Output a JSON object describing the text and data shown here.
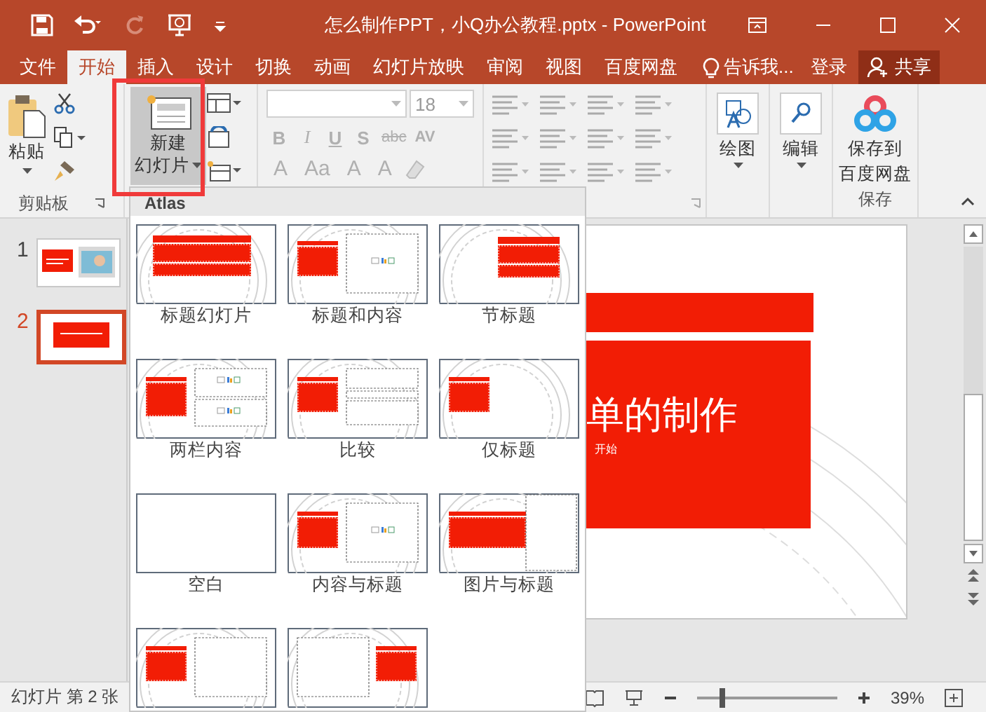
{
  "window": {
    "title": "怎么制作PPT，小Q办公教程.pptx - PowerPoint"
  },
  "tabs": [
    {
      "label": "文件",
      "selected": false
    },
    {
      "label": "开始",
      "selected": true
    },
    {
      "label": "插入",
      "selected": false
    },
    {
      "label": "设计",
      "selected": false
    },
    {
      "label": "切换",
      "selected": false
    },
    {
      "label": "动画",
      "selected": false
    },
    {
      "label": "幻灯片放映",
      "selected": false
    },
    {
      "label": "审阅",
      "selected": false
    },
    {
      "label": "视图",
      "selected": false
    },
    {
      "label": "百度网盘",
      "selected": false
    }
  ],
  "tell_me": "告诉我...",
  "sign_in": "登录",
  "share": "共享",
  "ribbon": {
    "clipboard": {
      "paste": "粘贴",
      "group_label": "剪贴板"
    },
    "slides": {
      "new_slide": [
        "新建",
        "幻灯片"
      ]
    },
    "font": {
      "size": "18",
      "row1": [
        {
          "label": "B",
          "disabled": true
        },
        {
          "label": "I",
          "disabled": true
        },
        {
          "label": "U",
          "disabled": true
        },
        {
          "label": "S",
          "disabled": true
        },
        {
          "label": "abc",
          "disabled": true
        },
        {
          "label": "AV",
          "disabled": true
        }
      ],
      "row2": [
        {
          "label": "A",
          "disabled": true
        },
        {
          "label": "Aa",
          "disabled": true
        },
        {
          "label": "A",
          "disabled": true
        },
        {
          "label": "A",
          "disabled": true
        }
      ]
    },
    "drawing": "绘图",
    "editing": "编辑",
    "save": {
      "button": [
        "保存到",
        "百度网盘"
      ],
      "group_label": "保存"
    }
  },
  "slides_panel": [
    {
      "number": "1",
      "selected": false,
      "kind": "photo"
    },
    {
      "number": "2",
      "selected": true,
      "kind": "title"
    }
  ],
  "gallery": {
    "header": "Atlas",
    "layouts": [
      {
        "kind": "title",
        "label": "标题幻灯片"
      },
      {
        "kind": "title-content",
        "label": "标题和内容"
      },
      {
        "kind": "section",
        "label": "节标题"
      },
      {
        "kind": "two-content",
        "label": "两栏内容"
      },
      {
        "kind": "comparison",
        "label": "比较"
      },
      {
        "kind": "title-only",
        "label": "仅标题"
      },
      {
        "kind": "blank",
        "label": "空白"
      },
      {
        "kind": "content-caption",
        "label": "内容与标题"
      },
      {
        "kind": "picture-caption",
        "label": "图片与标题"
      },
      {
        "kind": "title-left-box"
      },
      {
        "kind": "title-right-box"
      }
    ]
  },
  "slide": {
    "title": "单的制作",
    "subtitle": "开始"
  },
  "status_bar": {
    "slide_counter": "幻灯片 第 2 张",
    "zoom": {
      "level": 0.18,
      "reading": "39%"
    }
  }
}
